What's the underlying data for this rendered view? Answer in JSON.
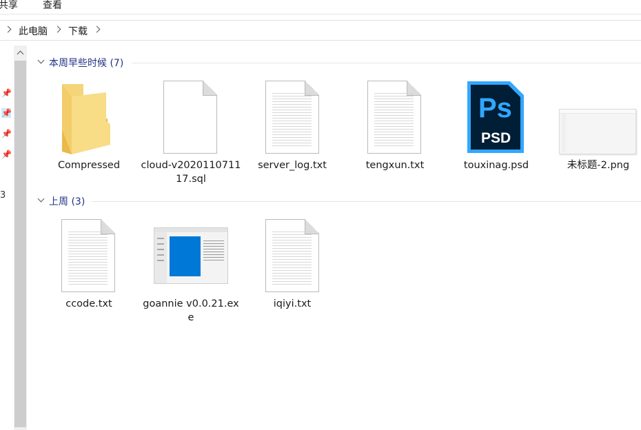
{
  "ribbon": {
    "tabs": [
      "共享",
      "查看"
    ]
  },
  "address_bar": {
    "path": [
      "此电脑",
      "下载"
    ]
  },
  "nav_pane": {
    "partial_text": "3"
  },
  "groups": [
    {
      "title": "本周早些时候 (7)",
      "items": [
        {
          "name": "Compressed",
          "icon": "folder-icon"
        },
        {
          "name": "cloud-v202011071117.sql",
          "icon": "blank-file-icon"
        },
        {
          "name": "server_log.txt",
          "icon": "text-file-icon"
        },
        {
          "name": "tengxun.txt",
          "icon": "text-file-icon"
        },
        {
          "name": "touxinag.psd",
          "icon": "photoshop-icon"
        },
        {
          "name": "未标题-2.png",
          "icon": "image-thumbnail-icon"
        }
      ]
    },
    {
      "title": "上周 (3)",
      "items": [
        {
          "name": "ccode.txt",
          "icon": "text-file-icon"
        },
        {
          "name": "goannie v0.0.21.exe",
          "icon": "app-thumbnail-icon"
        },
        {
          "name": "iqiyi.txt",
          "icon": "text-file-icon"
        }
      ]
    }
  ],
  "icon_labels": {
    "photoshop_ps": "Ps",
    "photoshop_psd": "PSD"
  },
  "colors": {
    "accent_header": "#1e3287",
    "selection": "#cce8ff",
    "folder": "#f5d47a",
    "photoshop_bg": "#001e36",
    "photoshop_accent": "#31a8ff",
    "app_blue": "#0078d7"
  }
}
